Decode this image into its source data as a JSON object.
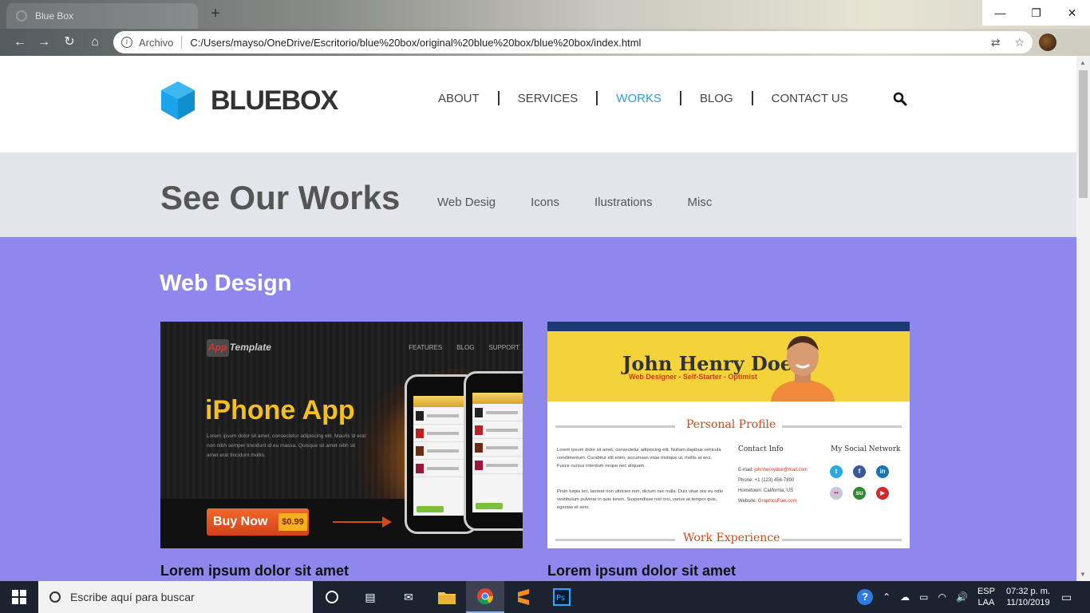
{
  "browser": {
    "tab_title": "Blue Box",
    "new_tab_label": "+",
    "controls": {
      "minimize": "—",
      "maximize": "❐",
      "close": "✕"
    },
    "address": {
      "scheme_label": "Archivo",
      "url": "C:/Users/mayso/OneDrive/Escritorio/blue%20box/original%20blue%20box/blue%20box/index.html"
    },
    "icons": [
      "back-icon",
      "forward-icon",
      "reload-icon",
      "home-icon",
      "info-icon",
      "translate-icon",
      "star-icon",
      "profile-avatar"
    ]
  },
  "site": {
    "brand": "BLUEBOX",
    "brand_color": "#1aa3e8",
    "nav": [
      {
        "label": "ABOUT",
        "active": false
      },
      {
        "label": "SERVICES",
        "active": false
      },
      {
        "label": "WORKS",
        "active": true
      },
      {
        "label": "BLOG",
        "active": false
      },
      {
        "label": "CONTACT US",
        "active": false
      }
    ],
    "search_icon": "search-icon",
    "works": {
      "title": "See Our Works",
      "filters": [
        "Web Desig",
        "Icons",
        "Ilustrations",
        "Misc"
      ]
    },
    "section": {
      "title": "Web Design",
      "background": "#8e88ee",
      "cards": [
        {
          "caption": "Lorem ipsum dolor sit amet",
          "thumb": {
            "logo_app": "App",
            "logo_template": " Template",
            "menu": [
              "FEATURES",
              "BLOG",
              "SUPPORT"
            ],
            "headline": "iPhone App",
            "blurb": "Lorem ipsum dolor sit amet, consectetur adipiscing elit. Mauris id erat non nibh semper tincidunt id eu massa. Quisque sit amet nibh sit amet erat tincidunt mollis.",
            "buy_label": "Buy Now",
            "price": "$0.99"
          }
        },
        {
          "caption": "Lorem ipsum dolor sit amet",
          "thumb": {
            "name": "John Henry Doe",
            "role": "Web Designer - Self-Starter - Optimist",
            "profile_heading": "Personal Profile",
            "profile_text_1": "Lorem ipsum dolor sit amet, consectetur adipiscing elit. Nullam dapibus vehicula condimentum. Curabitur elit enim, accumsan vitae tristique ut, mollis at orci. Fusce cursus interdum neque nec aliquam.",
            "profile_text_2": "Proin turpis leo, laoreet non ultricies non, dictum nec nulla. Duis vitae nisi eu odio vestibulum pulvinar in quis lorem. Suspendisse nisl orci, varius at tempor quis, egestas et sem.",
            "contact_heading": "Contact Info",
            "email_label": "E-mail:",
            "email": "johnhenrydoe@mail.com",
            "phone": "Phone: +1 (123) 456-7890",
            "hometown": "Hometown: California, US",
            "website_label": "Website:",
            "website": "GraphicsFuel.com",
            "social_heading": "My Social Network",
            "experience_heading": "Work Experience"
          }
        }
      ]
    }
  },
  "taskbar": {
    "search_placeholder": "Escribe aquí para buscar",
    "apps": [
      "task-view-icon",
      "mail-icon",
      "file-explorer-icon",
      "chrome-icon",
      "sublime-icon",
      "photoshop-icon"
    ],
    "lang_top": "ESP",
    "lang_bottom": "LAA",
    "time": "07:32 p. m.",
    "date": "11/10/2019"
  }
}
